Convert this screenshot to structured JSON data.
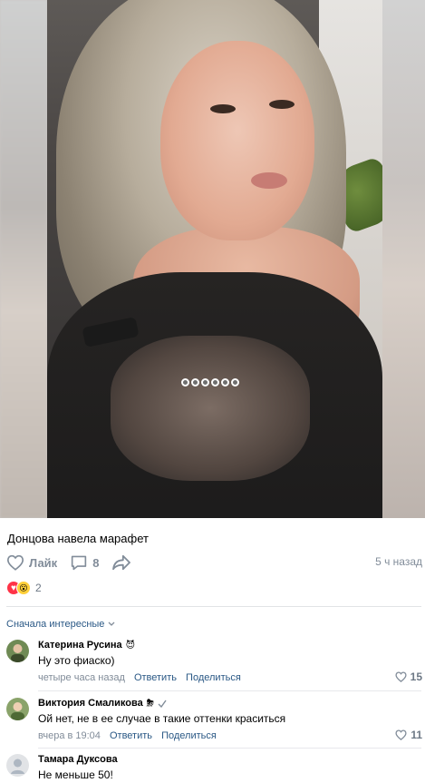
{
  "post": {
    "title": "Донцова навела марафет",
    "like_label": "Лайк",
    "comments_count": "8",
    "time": "5 ч назад",
    "reactions_count": "2"
  },
  "comments_section": {
    "sort_label": "Сначала интересные"
  },
  "comments": [
    {
      "author": "Катерина Русина",
      "author_badge": "😈",
      "text": "Ну это фиаско)",
      "time": "четыре часа назад",
      "reply_label": "Ответить",
      "share_label": "Поделиться",
      "likes": "15"
    },
    {
      "author": "Виктория Смаликова",
      "author_badge": "⛈",
      "text": "Ой нет, не в ее случае в такие оттенки краситься",
      "time": "вчера в 19:04",
      "reply_label": "Ответить",
      "share_label": "Поделиться",
      "likes": "11"
    },
    {
      "author": "Тамара Дуксова",
      "text": "Не меньше 50!"
    }
  ],
  "colors": {
    "link": "#2a5885",
    "secondary": "#818c99",
    "reaction_heart": "#ff3347",
    "reaction_wow": "#ffcf3a"
  }
}
